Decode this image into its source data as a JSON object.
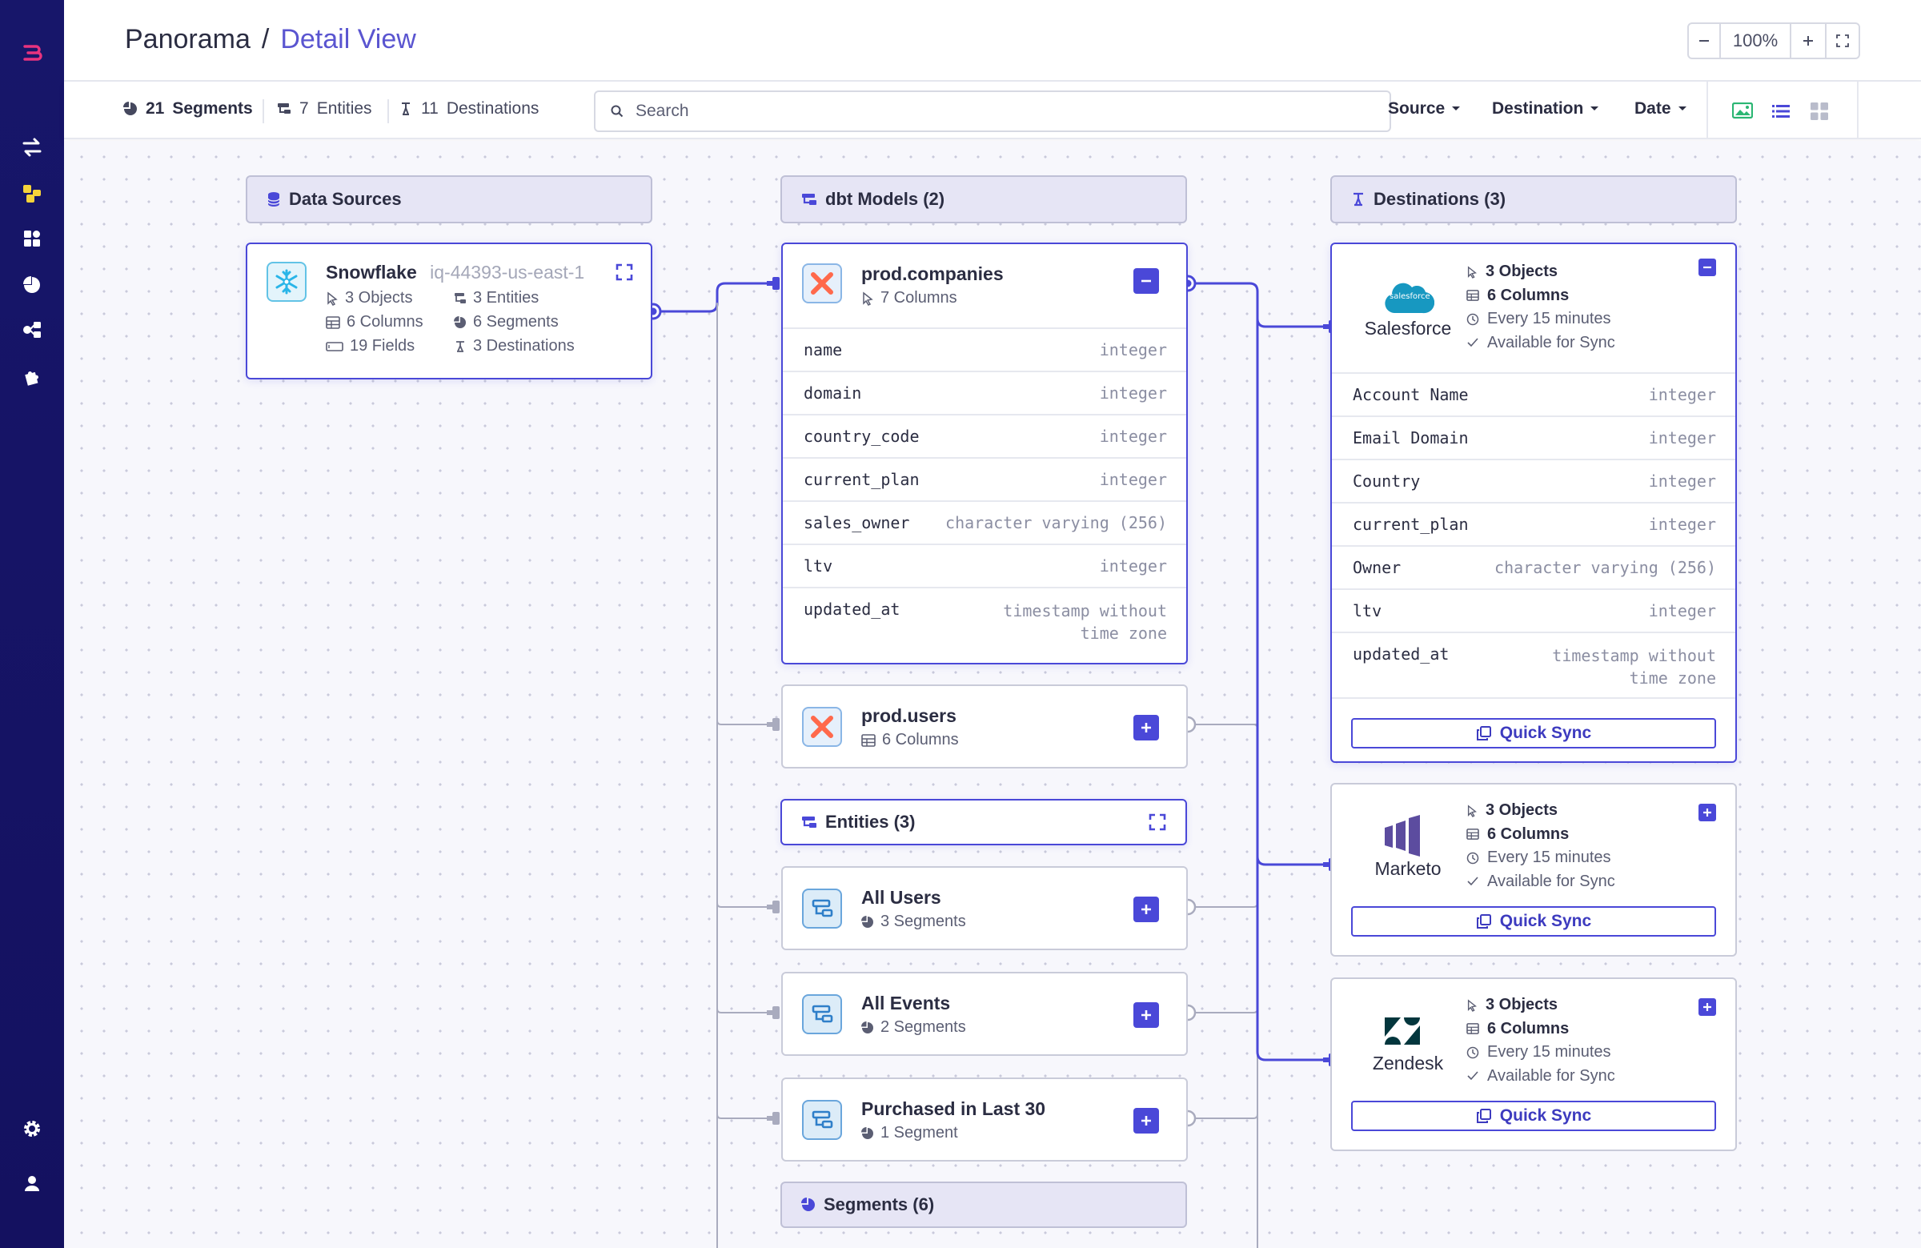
{
  "header": {
    "breadcrumb_root": "Panorama",
    "breadcrumb_sep": "/",
    "breadcrumb_current": "Detail View",
    "zoom_level": "100%"
  },
  "toolbar": {
    "segments_count": "21",
    "segments_label": "Segments",
    "entities_count": "7",
    "entities_label": "Entities",
    "destinations_count": "11",
    "destinations_label": "Destinations",
    "search_placeholder": "Search",
    "filter_source": "Source",
    "filter_destination": "Destination",
    "filter_date": "Date"
  },
  "groups": {
    "data_sources": "Data Sources",
    "dbt_models": "dbt Models (2)",
    "destinations": "Destinations (3)",
    "entities": "Entities (3)",
    "segments": "Segments (6)"
  },
  "source": {
    "name": "Snowflake",
    "region": "iq-44393-us-east-1",
    "objects": "3 Objects",
    "entities": "3 Entities",
    "columns": "6 Columns",
    "segments": "6 Segments",
    "fields": "19 Fields",
    "destinations": "3 Destinations"
  },
  "models": [
    {
      "name": "prod.companies",
      "columns_label": "7 Columns",
      "columns": [
        {
          "name": "name",
          "type": "integer"
        },
        {
          "name": "domain",
          "type": "integer"
        },
        {
          "name": "country_code",
          "type": "integer"
        },
        {
          "name": "current_plan",
          "type": "integer"
        },
        {
          "name": "sales_owner",
          "type": "character varying (256)"
        },
        {
          "name": "ltv",
          "type": "integer"
        },
        {
          "name": "updated_at",
          "type_line1": "timestamp without",
          "type_line2": "time zone"
        }
      ]
    },
    {
      "name": "prod.users",
      "columns_label": "6 Columns"
    }
  ],
  "entities": [
    {
      "name": "All Users",
      "segments": "3 Segments"
    },
    {
      "name": "All Events",
      "segments": "2 Segments"
    },
    {
      "name": "Purchased in Last 30",
      "segments": "1 Segment"
    }
  ],
  "destinations": [
    {
      "name": "Salesforce",
      "logo_text": "salesforce",
      "objects": "3 Objects",
      "columns": "6 Columns",
      "frequency": "Every 15 minutes",
      "status": "Available for Sync",
      "fields": [
        {
          "name": "Account Name",
          "type": "integer"
        },
        {
          "name": "Email Domain",
          "type": "integer"
        },
        {
          "name": "Country",
          "type": "integer"
        },
        {
          "name": "current_plan",
          "type": "integer"
        },
        {
          "name": "Owner",
          "type": "character varying (256)"
        },
        {
          "name": "ltv",
          "type": "integer"
        },
        {
          "name": "updated_at",
          "type_line1": "timestamp without",
          "type_line2": "time zone"
        }
      ],
      "action": "Quick Sync"
    },
    {
      "name": "Marketo",
      "objects": "3 Objects",
      "columns": "6 Columns",
      "frequency": "Every 15 minutes",
      "status": "Available for Sync",
      "action": "Quick Sync"
    },
    {
      "name": "Zendesk",
      "objects": "3 Objects",
      "columns": "6 Columns",
      "frequency": "Every 15 minutes",
      "status": "Available for Sync",
      "action": "Quick Sync"
    }
  ],
  "colors": {
    "rail": "#17166a",
    "accent": "#4a48d8",
    "breadcrumb_current": "#5a55d0",
    "group_header": "#e6e5f5"
  }
}
